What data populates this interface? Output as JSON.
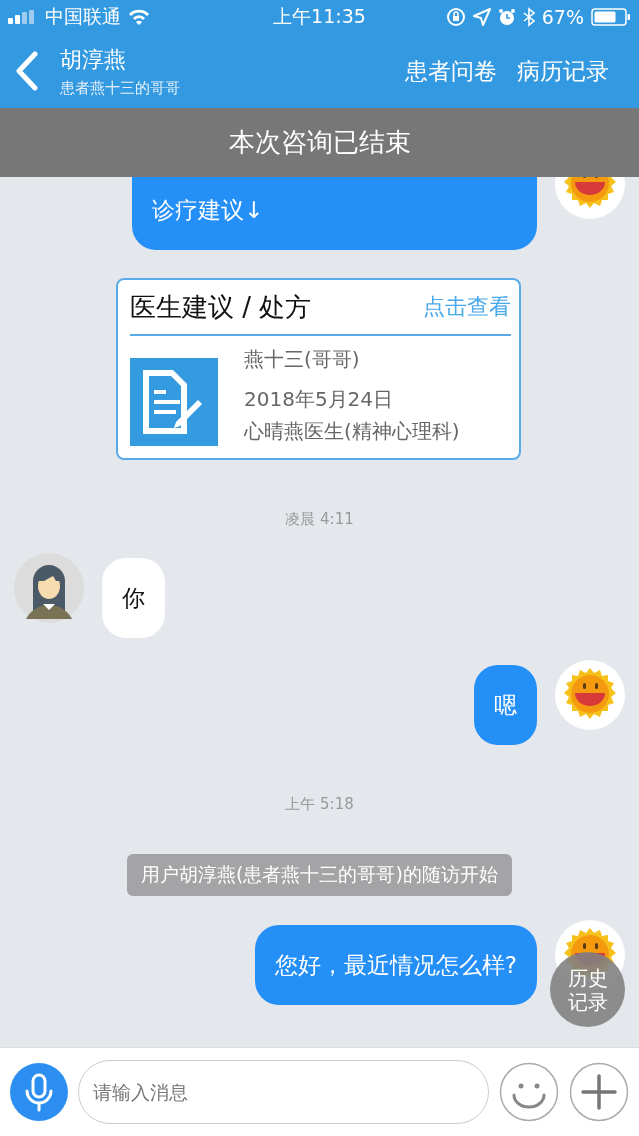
{
  "status_bar": {
    "carrier": "中国联通",
    "time": "上午11:35",
    "battery": "67%"
  },
  "header": {
    "title": "胡淳燕",
    "subtitle": "患者燕十三的哥哥",
    "actions": [
      "患者问卷",
      "病历记录"
    ]
  },
  "banner": {
    "text": "本次咨询已结束"
  },
  "messages": [
    {
      "kind": "sent",
      "text": "诊疗建议↓"
    },
    {
      "kind": "card",
      "title": "医生建议 / 处方",
      "link": "点击查看",
      "lines": [
        "燕十三(哥哥)",
        "2018年5月24日",
        "心晴燕医生(精神心理科)"
      ]
    },
    {
      "kind": "time",
      "text": "凌晨 4:11"
    },
    {
      "kind": "received",
      "text": "你"
    },
    {
      "kind": "sent",
      "text": "嗯"
    },
    {
      "kind": "time",
      "text": "上午 5:18"
    },
    {
      "kind": "system",
      "text": "用户胡淳燕(患者燕十三的哥哥)的随访开始"
    },
    {
      "kind": "sent",
      "text": "您好，最近情况怎么样?"
    }
  ],
  "floating_button": {
    "text": "历史记录"
  },
  "input_bar": {
    "placeholder": "请输入消息"
  }
}
